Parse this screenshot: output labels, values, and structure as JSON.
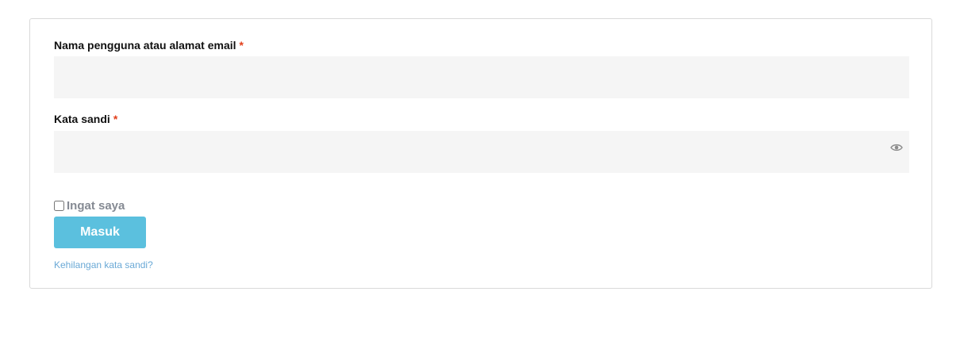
{
  "login_form": {
    "username": {
      "label": "Nama pengguna atau alamat email",
      "required_marker": "*",
      "value": "",
      "placeholder": ""
    },
    "password": {
      "label": "Kata sandi",
      "required_marker": "*",
      "value": "",
      "placeholder": "",
      "toggle_icon": "eye-icon"
    },
    "remember_me": {
      "label": "Ingat saya",
      "checked": false
    },
    "submit_label": "Masuk",
    "lost_password_link": "Kehilangan kata sandi?"
  },
  "colors": {
    "button_bg": "#5bc0de",
    "input_bg": "#f5f5f5",
    "required": "#e2401c",
    "link": "#6aa9d6",
    "remember_label": "#858a93"
  }
}
